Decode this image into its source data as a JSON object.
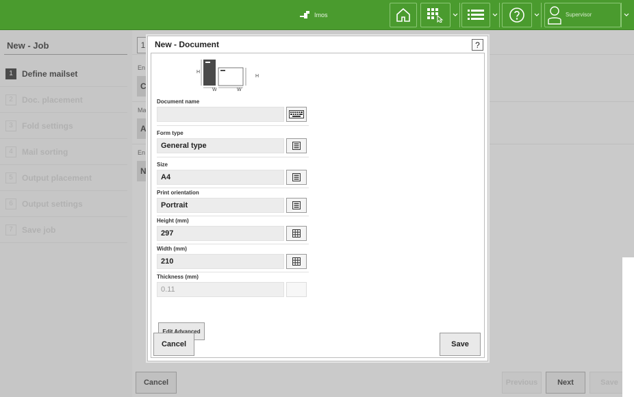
{
  "topbar": {
    "brand": "Imos",
    "user": "Supervisor",
    "colors": {
      "bar": "#4a9b2e",
      "outline": "#8bc775"
    },
    "icons": [
      "brand-logo-icon",
      "home-icon",
      "apps-icon",
      "list-icon",
      "help-icon",
      "user-icon",
      "chevron-down-icon"
    ]
  },
  "job": {
    "title": "New - Job",
    "tab_number": "1",
    "steps": [
      {
        "num": "1",
        "label": "Define mailset",
        "active": true
      },
      {
        "num": "2",
        "label": "Doc. placement",
        "active": false
      },
      {
        "num": "3",
        "label": "Fold settings",
        "active": false
      },
      {
        "num": "4",
        "label": "Mail sorting",
        "active": false
      },
      {
        "num": "5",
        "label": "Output placement",
        "active": false
      },
      {
        "num": "6",
        "label": "Output settings",
        "active": false
      },
      {
        "num": "7",
        "label": "Save job",
        "active": false
      }
    ],
    "bg_labels": [
      "En",
      "Ma",
      "En"
    ],
    "bg_values": [
      "C",
      "A",
      "N"
    ],
    "buttons": {
      "cancel": "Cancel",
      "previous": "Previous",
      "next": "Next",
      "save": "Save"
    }
  },
  "dialog": {
    "title": "New - Document",
    "help": "?",
    "diagram": {
      "h_label": "H",
      "w_label": "W"
    },
    "fields": {
      "document_name": {
        "label": "Document name",
        "value": ""
      },
      "form_type": {
        "label": "Form type",
        "value": "General type"
      },
      "size": {
        "label": "Size",
        "value": "A4"
      },
      "print_orientation": {
        "label": "Print orientation",
        "value": "Portrait"
      },
      "height": {
        "label": "Height (mm)",
        "value": "297"
      },
      "width": {
        "label": "Width (mm)",
        "value": "210"
      },
      "thickness": {
        "label": "Thickness (mm)",
        "value": "0.11"
      }
    },
    "buttons": {
      "edit_advanced": "Edit Advanced",
      "cancel": "Cancel",
      "save": "Save"
    }
  }
}
